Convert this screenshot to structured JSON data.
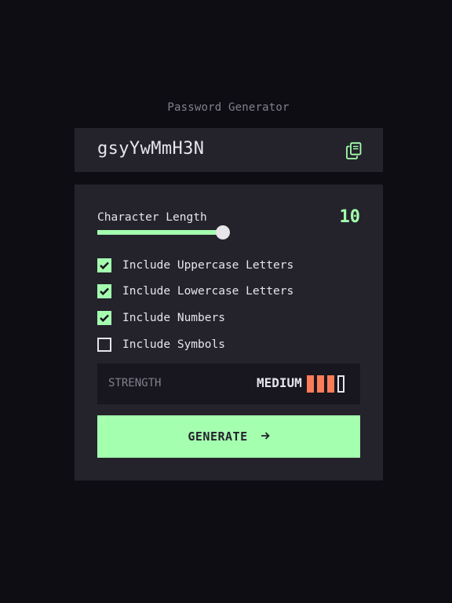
{
  "app": {
    "title": "Password Generator"
  },
  "password": {
    "value": "gsyYwMmH3N",
    "copy_icon": "copy-icon"
  },
  "length": {
    "label": "Character Length",
    "value": "10",
    "slider_fraction": 0.5
  },
  "options": [
    {
      "label": "Include Uppercase Letters",
      "checked": true
    },
    {
      "label": "Include Lowercase Letters",
      "checked": true
    },
    {
      "label": "Include Numbers",
      "checked": true
    },
    {
      "label": "Include Symbols",
      "checked": false
    }
  ],
  "strength": {
    "label": "STRENGTH",
    "value": "MEDIUM",
    "level": 3,
    "max_level": 4
  },
  "generate": {
    "label": "GENERATE",
    "icon": "arrow-right-icon"
  },
  "colors": {
    "background": "#0e0d13",
    "panel": "#24232c",
    "accent": "#a4ffaf",
    "strength_medium": "#fb7c58",
    "muted_text": "#827f8f"
  }
}
